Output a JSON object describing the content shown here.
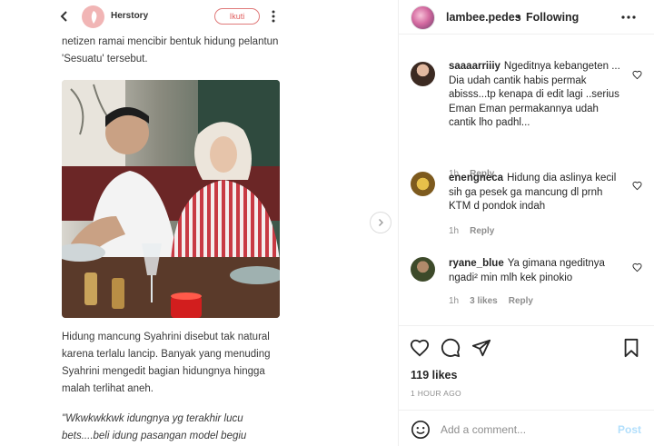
{
  "article": {
    "publisher": "Herstory",
    "follow_label": "Ikuti",
    "paragraph1": "netizen ramai mencibir bentuk hidung pelantun 'Sesuatu' tersebut.",
    "paragraph2": "Hidung mancung Syahrini disebut tak natural karena terlalu lancip. Banyak yang menuding Syahrini mengedit bagian hidungnya hingga malah terlihat aneh.",
    "paragraph3": "\"Wkwkwkkwk idungnya yg terakhir lucu bets....beli idung pasangan model begiu"
  },
  "header": {
    "username": "lambee.pedes",
    "separator": "•",
    "following_label": "Following"
  },
  "comments": [
    {
      "user": "saaaarriiiy",
      "text": "Ngeditnya kebangeten ... Dia udah cantik habis permak abisss...tp kenapa di edit lagi ..serius Eman Eman permakannya udah cantik lho padhl...",
      "time": "1h",
      "likes": "",
      "reply_label": "Reply"
    },
    {
      "user": "enengneca",
      "text": "Hidung dia aslinya kecil sih ga pesek ga mancung dl prnh KTM d pondok indah",
      "time": "1h",
      "likes": "",
      "reply_label": "Reply"
    },
    {
      "user": "ryane_blue",
      "text": "Ya gimana ngeditnya ngadi² min mlh kek pinokio",
      "time": "1h",
      "likes": "3 likes",
      "reply_label": "Reply"
    }
  ],
  "actions": {
    "likes": "119 likes",
    "time_ago": "1 HOUR AGO"
  },
  "add_comment": {
    "placeholder": "Add a comment...",
    "post_label": "Post"
  },
  "icons": {
    "back": "chevron-left-icon",
    "more_vertical": "more-vertical-icon",
    "next": "chevron-right-icon",
    "more_horizontal": "more-horizontal-icon",
    "heart": "heart-icon",
    "comment": "comment-icon",
    "share": "send-icon",
    "save": "bookmark-icon",
    "emoji": "emoji-icon"
  },
  "colors": {
    "follow_accent": "#e06060",
    "post_button": "#b2dffc",
    "meta_gray": "#8e8e8e"
  }
}
